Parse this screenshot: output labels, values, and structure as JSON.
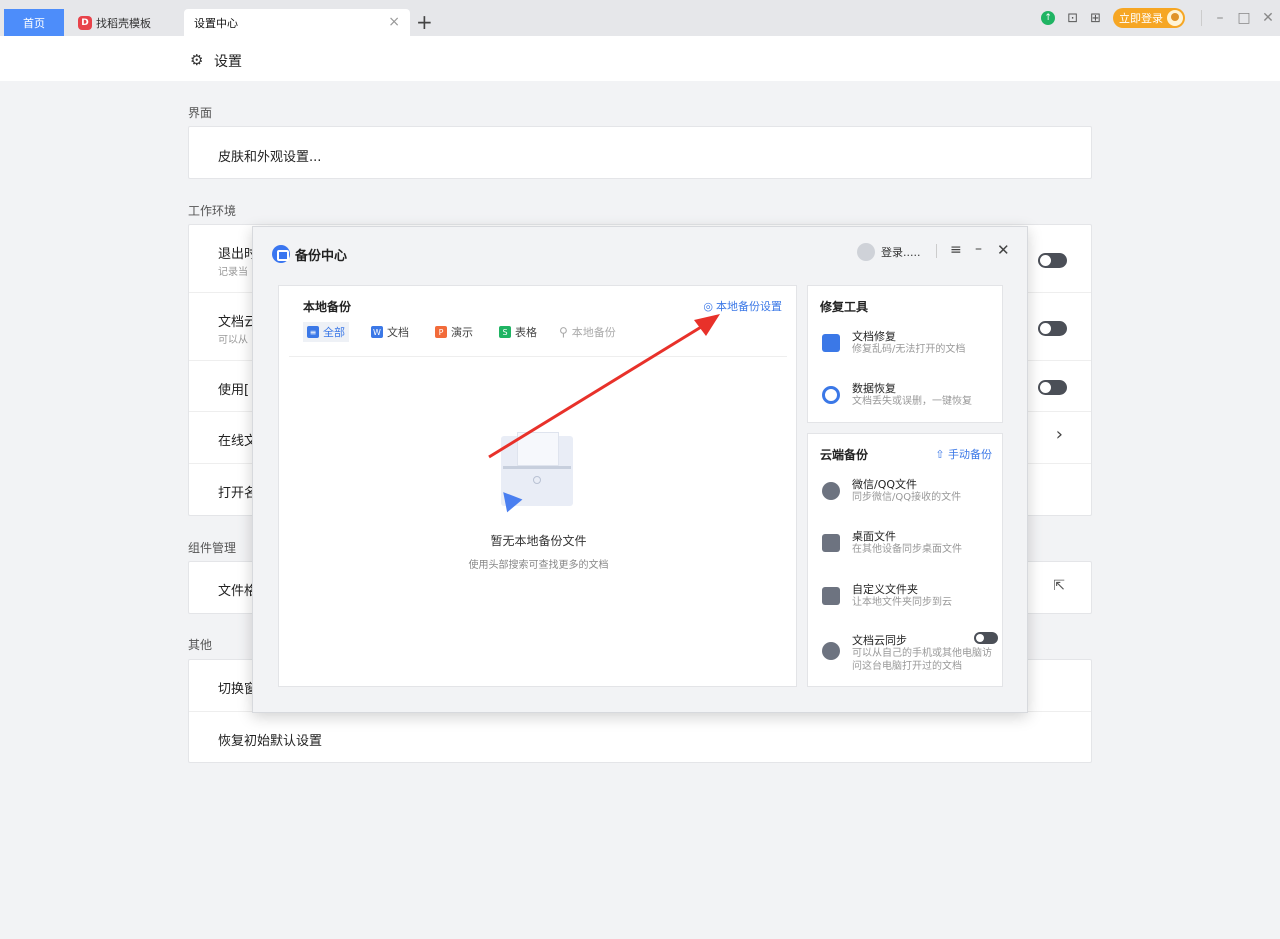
{
  "tabs": {
    "home": "首页",
    "template": "找稻壳模板",
    "template_logo": "D",
    "settings": "设置中心",
    "close": "×",
    "add": "+"
  },
  "toolbar": {
    "upgrade_icon": "↑",
    "layout_icon": "⊡",
    "apps_icon": "⊞",
    "login_label": "立即登录",
    "minimize": "–",
    "maximize": "□",
    "close": "✕"
  },
  "header": {
    "gear": "⚙",
    "title": "设置"
  },
  "sections": {
    "interface": {
      "label": "界面",
      "rows": [
        {
          "label": "皮肤和外观设置..."
        }
      ]
    },
    "workspace": {
      "label": "工作环境",
      "rows": [
        {
          "label": "退出时",
          "sub": "记录当"
        },
        {
          "label": "文档云",
          "sub": "可以从"
        },
        {
          "label": "使用["
        },
        {
          "label": "在线文",
          "chevron": "›"
        },
        {
          "label": "打开名"
        }
      ]
    },
    "components": {
      "label": "组件管理",
      "rows": [
        {
          "label": "文件格",
          "ext": "⇱"
        }
      ]
    },
    "other": {
      "label": "其他",
      "rows": [
        {
          "label": "切换窗"
        },
        {
          "label": "恢复初始默认设置"
        }
      ]
    }
  },
  "dialog": {
    "title": "备份中心",
    "user": "登录.....",
    "menu": "≡",
    "minimize": "–",
    "close": "✕",
    "local": {
      "title": "本地备份",
      "setting_icon": "◎",
      "setting": "本地备份设置",
      "tabs": [
        {
          "icon": "≡",
          "label": "全部",
          "color": "#3b78e7"
        },
        {
          "icon": "W",
          "label": "文档",
          "color": "#3b78e7"
        },
        {
          "icon": "P",
          "label": "演示",
          "color": "#f26b3a"
        },
        {
          "icon": "S",
          "label": "表格",
          "color": "#1fb463"
        }
      ],
      "search_icon": "⚲",
      "search_placeholder": "本地备份",
      "empty_title": "暂无本地备份文件",
      "empty_sub": "使用头部搜索可查找更多的文档"
    },
    "repair": {
      "title": "修复工具",
      "items": [
        {
          "title": "文档修复",
          "desc": "修复乱码/无法打开的文档",
          "icon_color": "#3b78e7"
        },
        {
          "title": "数据恢复",
          "desc": "文档丢失或误删，一键恢复",
          "icon_color": "#3b78e7"
        }
      ]
    },
    "cloud": {
      "title": "云端备份",
      "action_icon": "⇧",
      "action": "手动备份",
      "items": [
        {
          "title": "微信/QQ文件",
          "desc": "同步微信/QQ接收的文件"
        },
        {
          "title": "桌面文件",
          "desc": "在其他设备同步桌面文件"
        },
        {
          "title": "自定义文件夹",
          "desc": "让本地文件夹同步到云"
        },
        {
          "title": "文档云同步",
          "desc": "可以从自己的手机或其他电脑访问这台电脑打开过的文档"
        }
      ]
    }
  }
}
